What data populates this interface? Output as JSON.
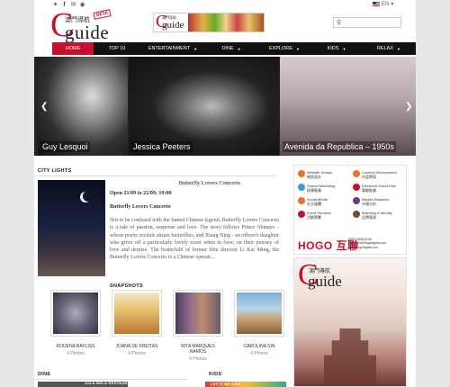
{
  "header": {
    "logo_cn": "澳門導航",
    "logo_c": "C",
    "logo_word": "guide",
    "beta": "BETA",
    "banner_cn": "澳門導航",
    "banner_c": "C",
    "banner_word": "guide",
    "language": "EN",
    "search_placeholder": ""
  },
  "nav": {
    "items": [
      {
        "label": "HOME",
        "active": true
      },
      {
        "label": "TOP 10"
      },
      {
        "label": "ENTERTAINMENT",
        "dropdown": true
      },
      {
        "label": "DINE",
        "dropdown": true
      },
      {
        "label": "EXPLORE",
        "dropdown": true
      },
      {
        "label": "KIDS",
        "dropdown": true
      },
      {
        "label": "RELAX",
        "dropdown": true
      }
    ]
  },
  "slider": {
    "slides": [
      {
        "caption": "Guy Lesquoi"
      },
      {
        "caption": "Jessica Peeters"
      },
      {
        "caption": "Avenida da Republica – 1950s"
      }
    ]
  },
  "city_lights": {
    "label": "CITY LIGHTS",
    "title": "Butterfly Lovers Concerto",
    "date": "Open 21/09 to 22/09; 19:00",
    "subtitle": "Butterfly Lovers Concerto",
    "description": "Not to be confused with the famed Chinese legend, Butterfly Lovers Concerto is a tale of passion, suspense and love. The story follows Prince Shinayo - whose poetic recitals attract butterflies, and Xiang Ning - an officer's daughter who gives off a particularly lovely scent when in love; on their journey of love and demise. The brainchild of former film director Li Kai Ming, the Butterfly Lovers Concerto is a Chinese operati..."
  },
  "snapshots": {
    "label": "SNAPSHOTS",
    "items": [
      {
        "name": "ROUENA BAYLISS",
        "count": "4 Photos"
      },
      {
        "name": "JOANA DE FREITAS",
        "count": "4 Photos"
      },
      {
        "name": "RITA MARQUES RAMOS",
        "count": "4 Photos"
      },
      {
        "name": "CAROLINA SIN",
        "count": "4 Photos"
      }
    ]
  },
  "footer_sections": {
    "dine_label": "DINE",
    "dine_preview": "JOLA BELA RESTAURANT",
    "kids_label": "KIDS",
    "kids_preview": "LET IT BE KIDS"
  },
  "sidebar_ad": {
    "services": [
      {
        "en": "Website Design",
        "cn": "網頁設計",
        "color": "#e8742a"
      },
      {
        "en": "Content Development",
        "cn": "內容撰寫",
        "color": "#e8742a"
      },
      {
        "en": "Search Marketing",
        "cn": "搜尋推廣",
        "color": "#3a9ad9"
      },
      {
        "en": "Electronic Direct Mail",
        "cn": "電郵推廣",
        "color": "#c8102e"
      },
      {
        "en": "Social Media",
        "cn": "社交媒體",
        "color": "#e8742a"
      },
      {
        "en": "Market Research",
        "cn": "市場分析",
        "color": "#6a3a8a"
      },
      {
        "en": "Event Services",
        "cn": "活動策劃",
        "color": "#c8102e"
      },
      {
        "en": "Branding & Identity",
        "cn": "品牌管理",
        "color": "#7a4a2a"
      }
    ],
    "brand": "HOGO 互聯",
    "phone": "(853) 2835 6108",
    "email": "enquiries@hogodigital.com",
    "web": "www.hogodigital.com"
  },
  "sidebar_cover": {
    "cn": "澳門導航",
    "c": "C",
    "word": "guide"
  },
  "colors": {
    "accent": "#c8102e",
    "nav_bg": "#111111"
  }
}
